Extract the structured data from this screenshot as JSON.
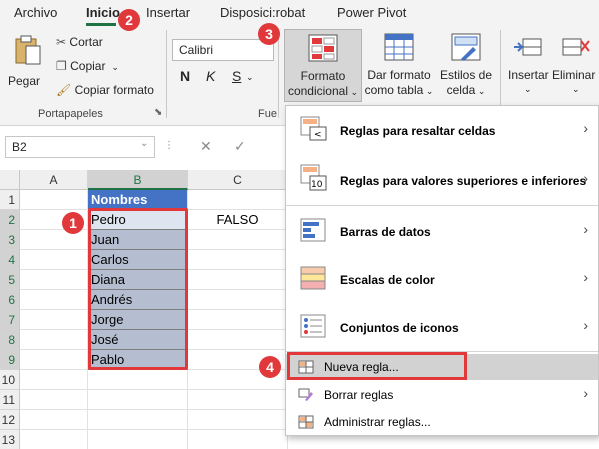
{
  "menubar": {
    "tabs": [
      "Archivo",
      "Inicio",
      "Insertar",
      "Disposici:robat",
      "Power Pivot"
    ],
    "active_tab": "Inicio"
  },
  "ribbon": {
    "paste": "Pegar",
    "cut": "Cortar",
    "copy": "Copiar",
    "copy_format": "Copiar formato",
    "clipboard_group": "Portapapeles",
    "font_name": "Calibri",
    "bold": "N",
    "italic": "K",
    "underline": "S",
    "font_group_partial": "Fue",
    "cond_format_line1": "Formato",
    "cond_format_line2": "condicional",
    "format_table_line1": "Dar formato",
    "format_table_line2": "como tabla",
    "cell_styles_line1": "Estilos de",
    "cell_styles_line2": "celda",
    "insert": "Insertar",
    "delete": "Eliminar"
  },
  "formula_bar": {
    "name_box": "B2",
    "cancel": "✕",
    "enter": "✓"
  },
  "grid": {
    "columns": [
      "A",
      "B",
      "C"
    ],
    "rows": [
      "1",
      "2",
      "3",
      "4",
      "5",
      "6",
      "7",
      "8",
      "9",
      "10",
      "11",
      "12",
      "13"
    ],
    "header": "Nombres",
    "names": [
      "Pedro",
      "Juan",
      "Carlos",
      "Diana",
      "Andrés",
      "Jorge",
      "José",
      "Pablo"
    ],
    "c2_value": "FALSO"
  },
  "menu": {
    "items": [
      {
        "label": "Reglas para resaltar celdas",
        "submenu": true
      },
      {
        "label": "Reglas para valores superiores e inferiores",
        "submenu": true
      },
      {
        "label": "Barras de datos",
        "submenu": true
      },
      {
        "label": "Escalas de color",
        "submenu": true
      },
      {
        "label": "Conjuntos de iconos",
        "submenu": true
      }
    ],
    "new_rule": "Nueva regla...",
    "clear_rules": "Borrar reglas",
    "manage_rules": "Administrar reglas..."
  },
  "badges": [
    "1",
    "2",
    "3",
    "4"
  ],
  "colors": {
    "accent_green": "#217346",
    "table_header": "#4472c4",
    "table_band": "#b5bed0",
    "annotation_red": "#e0383b"
  }
}
